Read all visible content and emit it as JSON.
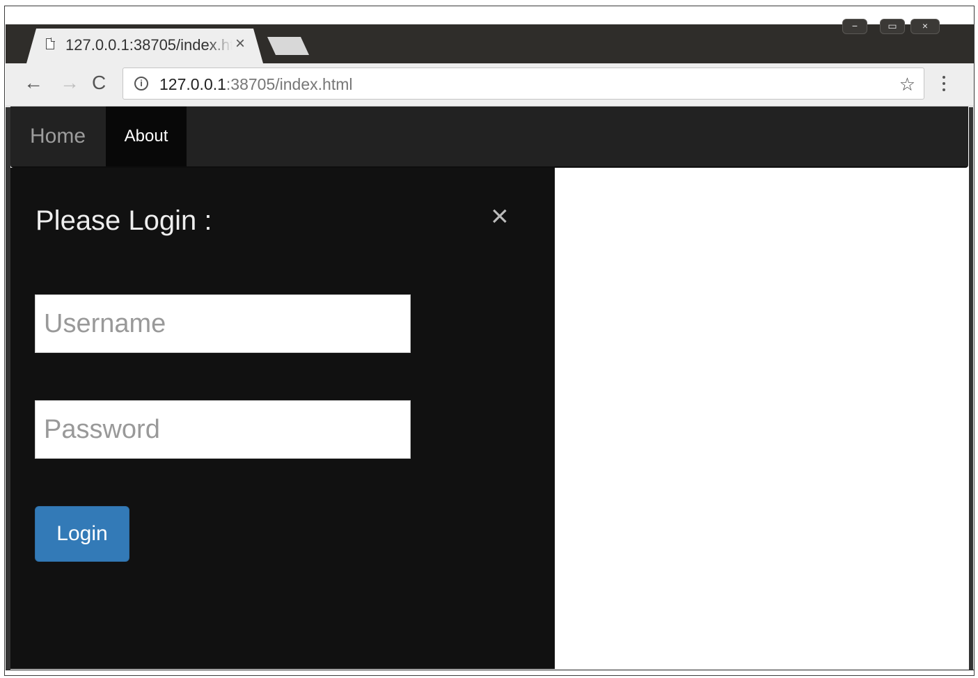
{
  "browser": {
    "tab": {
      "title": "127.0.0.1:38705/index.html",
      "close_glyph": "×",
      "icon": "page-icon"
    },
    "window_controls": {
      "minimize": "−",
      "maximize": "▭",
      "close": "×"
    },
    "toolbar": {
      "back_glyph": "←",
      "forward_glyph": "→",
      "reload_glyph": "C",
      "url_host": "127.0.0.1",
      "url_path": ":38705/index.html",
      "info_glyph": "i",
      "star_glyph": "☆"
    }
  },
  "navbar": {
    "items": [
      {
        "label": "Home",
        "active": false
      },
      {
        "label": "About",
        "active": true
      }
    ],
    "background": "#222222"
  },
  "login": {
    "title": "Please Login :",
    "close_glyph": "×",
    "username_placeholder": "Username",
    "password_placeholder": "Password",
    "button_label": "Login",
    "button_color": "#337ab7",
    "panel_color": "#111111"
  }
}
